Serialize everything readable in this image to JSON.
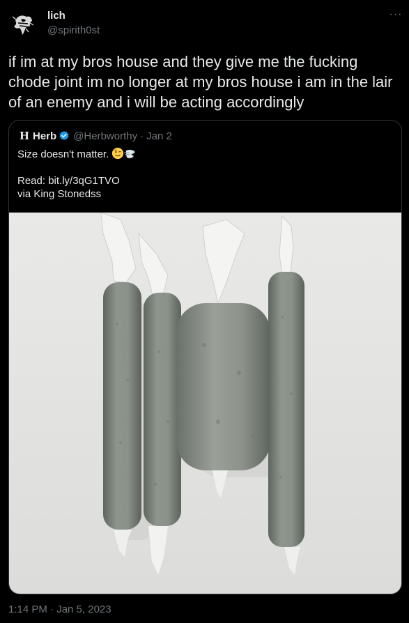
{
  "author": {
    "display_name": "lich",
    "handle": "@spirith0st",
    "avatar_icon": "skeleton-avatar-icon"
  },
  "more_icon": "more-horizontal-icon",
  "tweet": {
    "text": "if im at my bros house and they give me the fucking chode joint im no longer at my bros house i am in the lair of an enemy and i will be acting accordingly",
    "timestamp": "1:14 PM · Jan 5, 2023"
  },
  "quoted": {
    "avatar_letter": "H",
    "display_name": "Herb",
    "verified_icon": "verified-badge-icon",
    "handle": "@Herbworthy",
    "separator": "·",
    "date": "Jan 2",
    "line1": "Size doesn't matter.",
    "emojis": [
      "winking-face-icon",
      "dashing-away-icon"
    ],
    "line2": "Read: bit.ly/3qG1TVO",
    "line3": "via King Stonedss",
    "image": "photo of four joints, the third short and very thick"
  },
  "colors": {
    "background": "#000000",
    "text": "#e7e9ea",
    "secondary": "#71767b",
    "border": "#2f3336",
    "verified": "#1d9bf0"
  }
}
